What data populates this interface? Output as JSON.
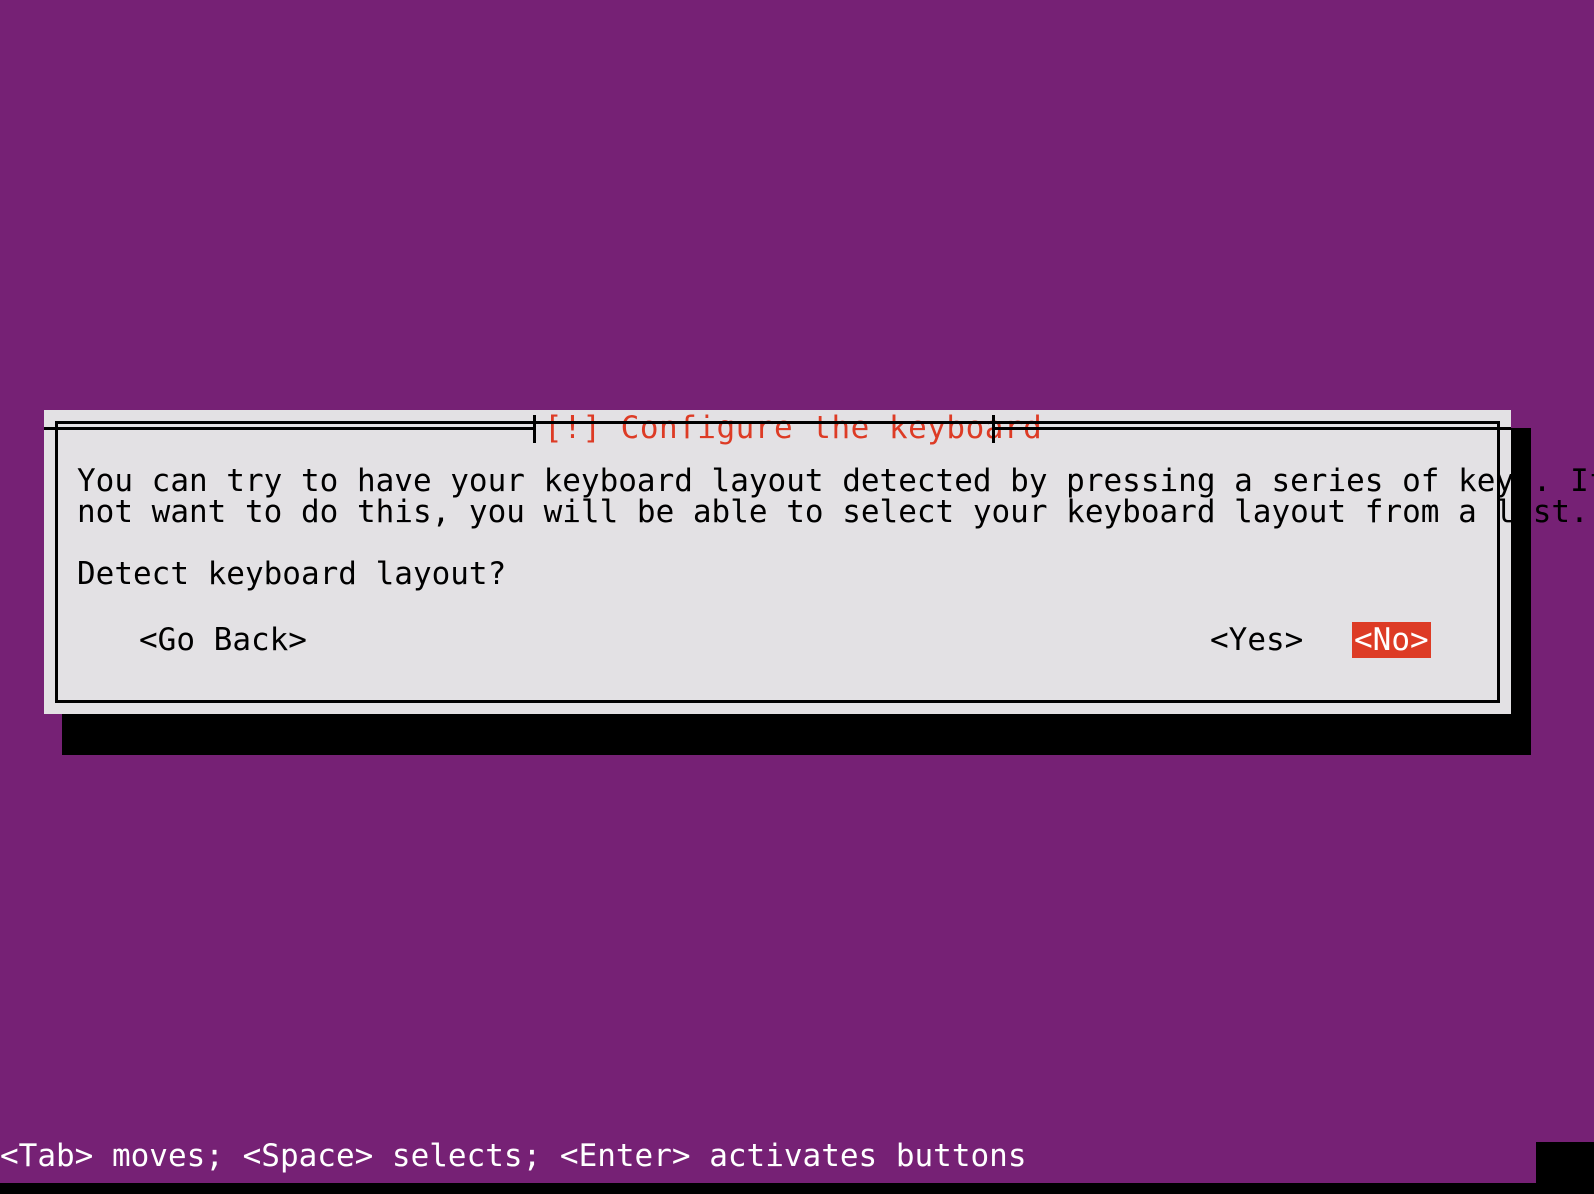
{
  "screen": {
    "background_color": "#762175",
    "edge_color": "#000000"
  },
  "dialog": {
    "title": "[!] Configure the keyboard",
    "title_color": "#dd3b25",
    "background_color": "#e3e1e4",
    "border_color": "#000000",
    "body_lines": [
      "You can try to have your keyboard layout detected by pressing a series of keys. If you do",
      "not want to do this, you will be able to select your keyboard layout from a list."
    ],
    "question": "Detect keyboard layout?",
    "buttons": {
      "go_back": "<Go Back>",
      "yes": "<Yes>",
      "no": "<No>",
      "selected": "<No>",
      "highlight_background": "#dd3b25",
      "highlight_text_color": "#ffffff"
    }
  },
  "status_bar": {
    "text": "<Tab> moves; <Space> selects; <Enter> activates buttons",
    "text_color": "#ffffff"
  }
}
